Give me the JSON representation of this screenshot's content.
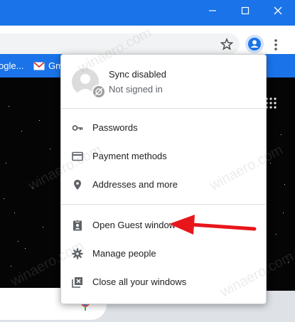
{
  "colors": {
    "accent": "#1a73e8",
    "arrow": "#e8151b"
  },
  "bookmarks": [
    "ogle...",
    "Gm"
  ],
  "profile": {
    "title": "Sync disabled",
    "subtitle": "Not signed in"
  },
  "menu_items": [
    {
      "icon": "key-icon",
      "label": "Passwords"
    },
    {
      "icon": "credit-card-icon",
      "label": "Payment methods"
    },
    {
      "icon": "location-pin-icon",
      "label": "Addresses and more"
    },
    {
      "icon": "guest-badge-icon",
      "label": "Open Guest window"
    },
    {
      "icon": "gear-icon",
      "label": "Manage people"
    },
    {
      "icon": "close-windows-icon",
      "label": "Close all your windows"
    }
  ],
  "watermark": "winaero.com"
}
